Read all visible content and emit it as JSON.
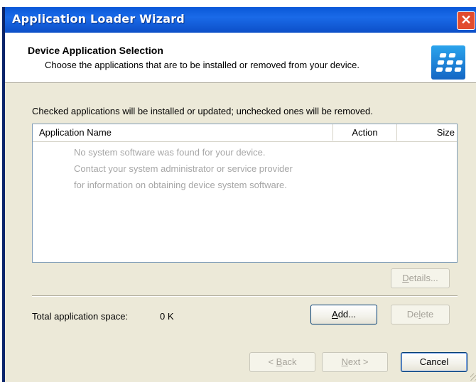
{
  "window": {
    "title": "Application Loader Wizard",
    "close_label": "✕"
  },
  "header": {
    "title": "Device Application Selection",
    "subtitle": "Choose the applications that are to be installed or removed from your device."
  },
  "instructions": "Checked applications will be installed or updated; unchecked ones will be removed.",
  "list": {
    "columns": [
      "Application Name",
      "Action",
      "Size"
    ],
    "empty_message": [
      "No system software was found for your device.",
      "Contact your system administrator or service provider",
      "for information on obtaining device system software."
    ]
  },
  "buttons": {
    "details": {
      "prefix": "",
      "key": "D",
      "rest": "etails...",
      "enabled": false
    },
    "add": {
      "prefix": "",
      "key": "A",
      "rest": "dd...",
      "enabled": true
    },
    "delete": {
      "prefix": "De",
      "key": "l",
      "rest": "ete",
      "enabled": false
    },
    "back": {
      "prefix": "< ",
      "key": "B",
      "rest": "ack",
      "enabled": false
    },
    "next": {
      "prefix": "",
      "key": "N",
      "rest": "ext >",
      "enabled": false
    },
    "cancel": {
      "prefix": "",
      "key": "",
      "rest": "Cancel",
      "enabled": true
    }
  },
  "space": {
    "label": "Total application space:",
    "value": "0 K"
  },
  "colors": {
    "titlebar": "#0A58D8",
    "dialog_bg": "#ECE9D8",
    "logo": "#1A7FD8",
    "disabled_text": "#A6A39A"
  }
}
